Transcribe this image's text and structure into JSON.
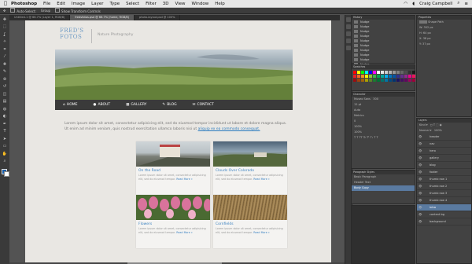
{
  "menubar": {
    "app": "Photoshop",
    "items": [
      "File",
      "Edit",
      "Image",
      "Layer",
      "Type",
      "Select",
      "Filter",
      "3D",
      "View",
      "Window",
      "Help"
    ],
    "user": "Craig Campbell"
  },
  "options_bar": {
    "items": [
      "Auto-Select:",
      "Group",
      "Show Transform Controls"
    ]
  },
  "doc_tabs": [
    {
      "label": "Untitled-1 @ 66.7% (Layer 1, RGB/8)",
      "active": false
    },
    {
      "label": "fredsfotos.psd @ 66.7% (home, RGB/8)",
      "active": true
    },
    {
      "label": "photo-layout.psd @ 100%",
      "active": false
    }
  ],
  "tools": [
    "move",
    "marquee",
    "lasso",
    "quick-select",
    "crop",
    "eyedropper",
    "healing",
    "brush",
    "clone",
    "history-brush",
    "eraser",
    "gradient",
    "blur",
    "dodge",
    "pen",
    "type",
    "path-select",
    "shape",
    "hand",
    "zoom"
  ],
  "page": {
    "logo_line1": "FRED'S",
    "logo_line2": "FOTOS",
    "tagline": "Nature Photography",
    "nav": [
      {
        "label": "HOME",
        "icon": "home-icon",
        "glyph": "⌂"
      },
      {
        "label": "ABOUT",
        "icon": "user-icon",
        "glyph": "●"
      },
      {
        "label": "GALLERY",
        "icon": "gallery-icon",
        "glyph": "▦"
      },
      {
        "label": "BLOG",
        "icon": "pencil-icon",
        "glyph": "✎"
      },
      {
        "label": "CONTACT",
        "icon": "mail-icon",
        "glyph": "✉"
      }
    ],
    "intro_text": "Lorem ipsum dolor sit amet, consectetur adipisicing elit, sed do eiusmod tempor incididunt ut labore et dolore magna aliqua. Ut enim ad minim veniam, quis nostrud exercitation ullamco laboris nisi ut",
    "intro_link": "aliquip ex ea commodo consequat.",
    "cards": [
      {
        "title": "On the Road",
        "text": "Lorem ipsum dolor sit amet, consectetur adipisicing elit, sed do eiusmod tempor.",
        "more": "Read More »"
      },
      {
        "title": "Clouds Over Colorado",
        "text": "Lorem ipsum dolor sit amet, consectetur adipisicing elit, sed do eiusmod tempor.",
        "more": "Read More »"
      },
      {
        "title": "Flowers",
        "text": "Lorem ipsum dolor sit amet, consectetur adipisicing elit, sed do eiusmod tempor.",
        "more": "Read More »"
      },
      {
        "title": "Cornfields",
        "text": "Lorem ipsum dolor sit amet, consectetur adipisicing elit, sed do eiusmod tempor.",
        "more": "Read More »"
      }
    ]
  },
  "history_panel": {
    "title": "History",
    "items": [
      "Nudge",
      "Nudge",
      "Nudge",
      "Nudge",
      "Nudge",
      "Nudge",
      "Nudge",
      "Nudge",
      "Nudge",
      "Nudge",
      "Nudge",
      "Nudge",
      "Layer Order"
    ]
  },
  "swatches_panel": {
    "title": "Swatches",
    "colors": [
      "#ff0000",
      "#ffff00",
      "#00ff00",
      "#00ffff",
      "#0000ff",
      "#ff00ff",
      "#ffffff",
      "#e6e6e6",
      "#cccccc",
      "#b3b3b3",
      "#999999",
      "#808080",
      "#666666",
      "#4d4d4d",
      "#333333",
      "#1a1a1a",
      "#000000",
      "#ff6666",
      "#ed1c24",
      "#f26522",
      "#f7941d",
      "#fff200",
      "#8dc63f",
      "#39b54a",
      "#00a651",
      "#00a99d",
      "#00aeef",
      "#0072bc",
      "#0054a6",
      "#2e3192",
      "#662d91",
      "#92278f",
      "#ec008c",
      "#ed145b",
      "#f69679",
      "#fbaf5d",
      "#9e0b0f",
      "#a0410d",
      "#a36209",
      "#aba000",
      "#598527",
      "#1a7b30",
      "#007236",
      "#00746b",
      "#0076a3",
      "#004a80",
      "#003471",
      "#1b1464",
      "#440e62",
      "#630460",
      "#9e005d",
      "#9e0039",
      "#c69c6d",
      "#8c6239"
    ]
  },
  "properties_panel": {
    "title": "Properties",
    "label": "Shape Path",
    "rows": [
      "W: 302 px",
      "H: 64 px",
      "X: 38 px",
      "Y: 37 px"
    ]
  },
  "character_panel": {
    "title": "Character",
    "font": "Museo Sans",
    "style": "300",
    "rows": [
      "12 pt",
      "Auto",
      "Metrics",
      "0",
      "100%",
      "100%"
    ]
  },
  "paragraph_styles_panel": {
    "title": "Paragraph Styles",
    "items": [
      "Basic Paragraph",
      "Header Text",
      "Body Copy"
    ]
  },
  "layers_panel": {
    "title": "Layers",
    "items": [
      "header",
      "nav",
      "hero",
      "gallery",
      "blog",
      "footer",
      "thumb row 1",
      "thumb row 2",
      "thumb row 3",
      "thumb row 4",
      "intro",
      "content bg",
      "background"
    ],
    "selected_index": 10
  }
}
